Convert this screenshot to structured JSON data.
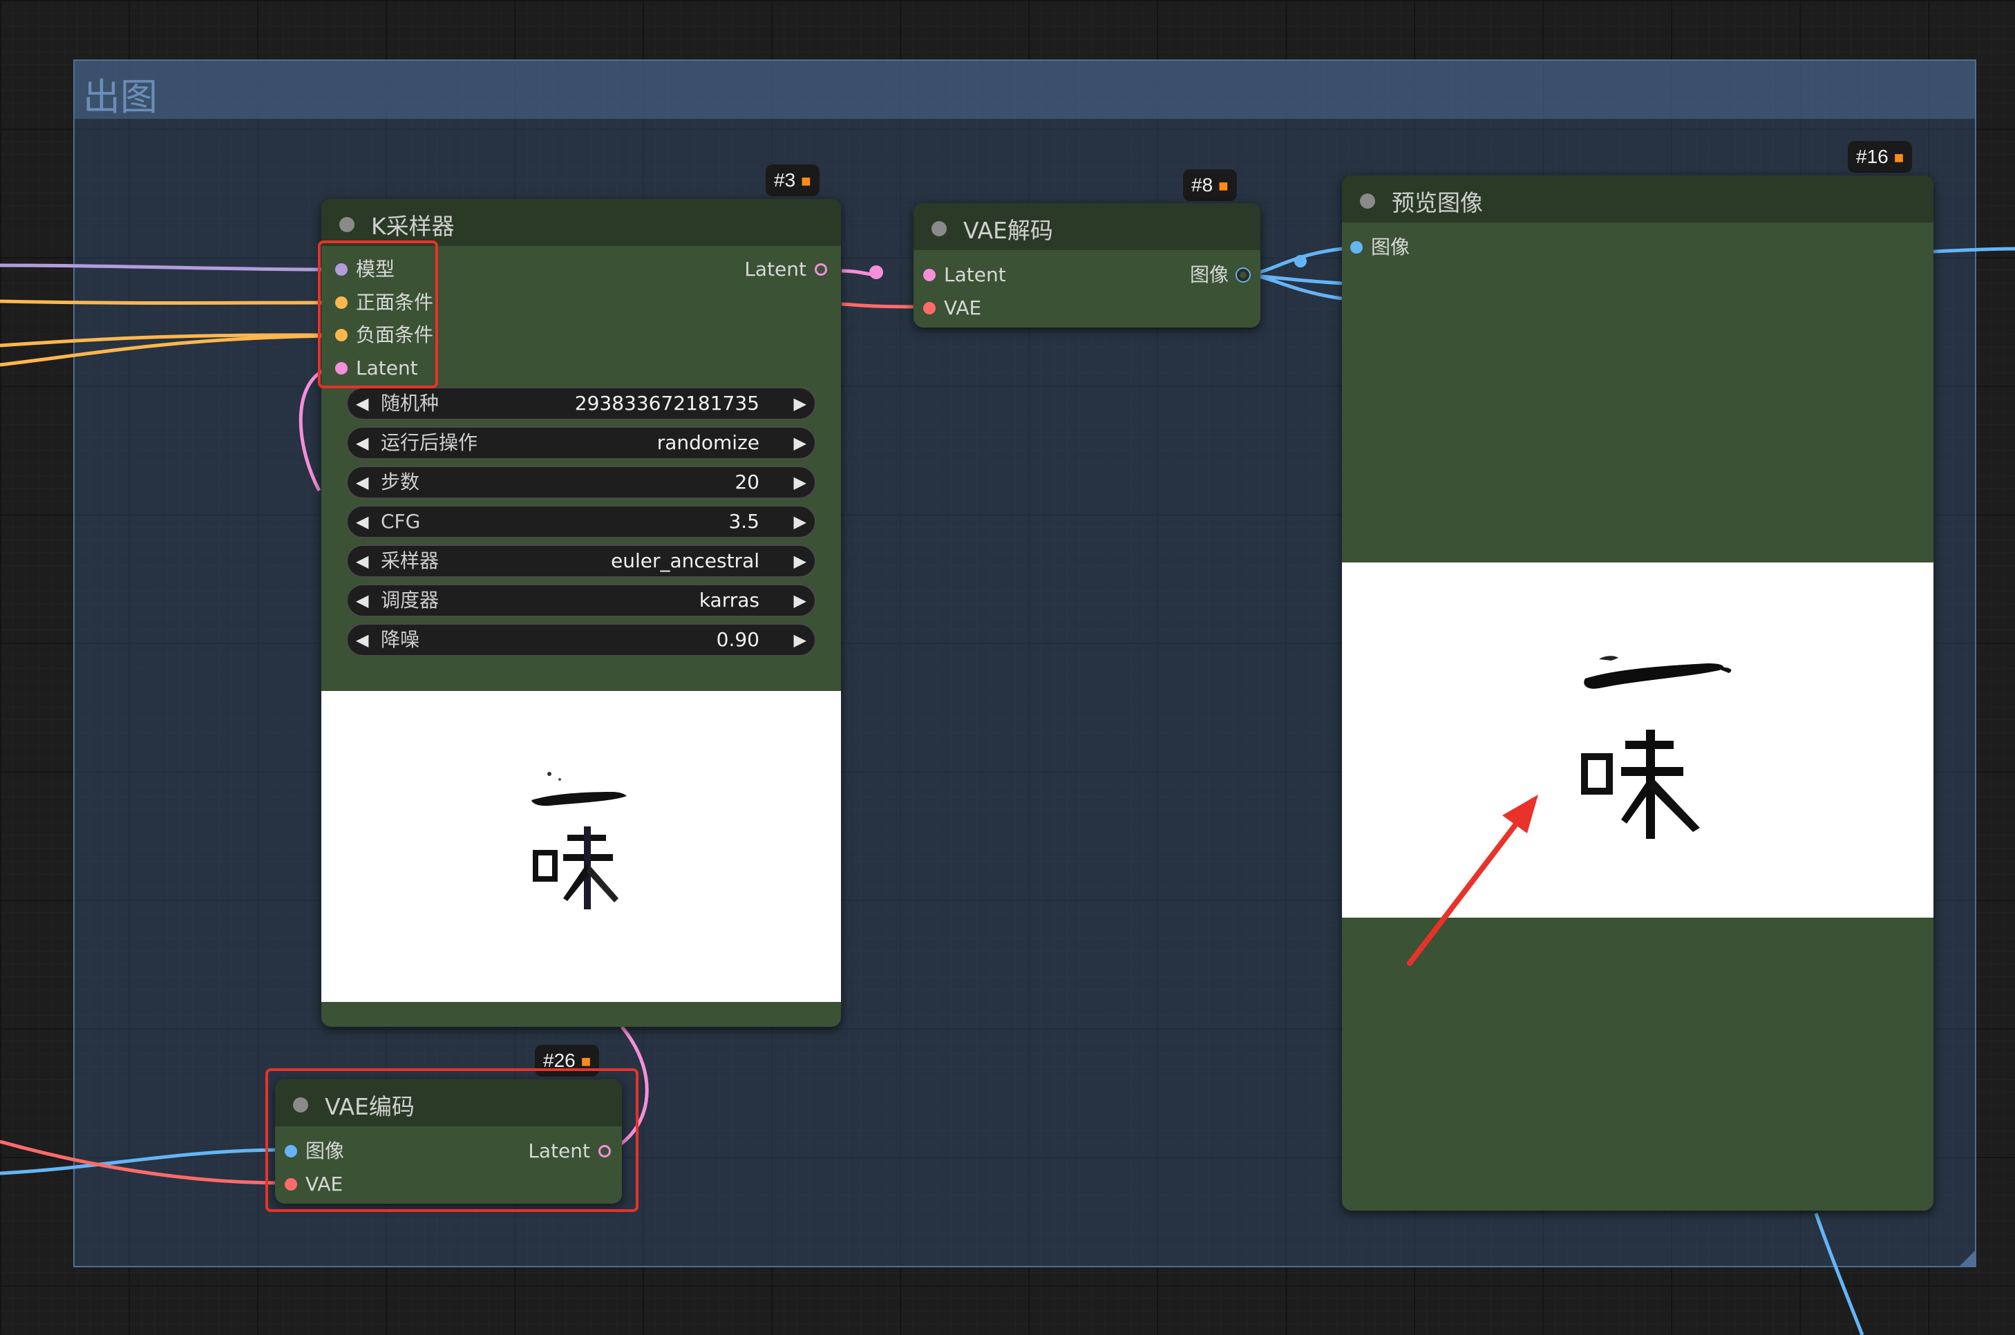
{
  "group": {
    "title": "出图"
  },
  "nodes": {
    "ksampler": {
      "badge": "#3",
      "title": "K采样器",
      "inputs": [
        {
          "label": "模型",
          "color": "#b39ddb"
        },
        {
          "label": "正面条件",
          "color": "#ffb74d"
        },
        {
          "label": "负面条件",
          "color": "#ffb74d"
        },
        {
          "label": "Latent",
          "color": "#f48fda"
        }
      ],
      "output": {
        "label": "Latent",
        "color": "#f48fda"
      },
      "widgets": [
        {
          "label": "随机种",
          "value": "293833672181735"
        },
        {
          "label": "运行后操作",
          "value": "randomize"
        },
        {
          "label": "步数",
          "value": "20"
        },
        {
          "label": "CFG",
          "value": "3.5"
        },
        {
          "label": "采样器",
          "value": "euler_ancestral"
        },
        {
          "label": "调度器",
          "value": "karras"
        },
        {
          "label": "降噪",
          "value": "0.90"
        }
      ]
    },
    "vae_decode": {
      "badge": "#8",
      "title": "VAE解码",
      "inputs": [
        {
          "label": "Latent",
          "color": "#f48fda"
        },
        {
          "label": "VAE",
          "color": "#ff6b6b"
        }
      ],
      "output": {
        "label": "图像",
        "color": "#64b5f6"
      }
    },
    "preview": {
      "badge": "#16",
      "title": "预览图像",
      "inputs": [
        {
          "label": "图像",
          "color": "#64b5f6"
        }
      ]
    },
    "vae_encode": {
      "badge": "#26",
      "title": "VAE编码",
      "inputs": [
        {
          "label": "图像",
          "color": "#64b5f6"
        },
        {
          "label": "VAE",
          "color": "#ff6b6b"
        }
      ],
      "output": {
        "label": "Latent",
        "color": "#f48fda"
      }
    }
  },
  "colors": {
    "node_body": "#3b5234",
    "node_header": "#2b3a26",
    "highlight": "#e8322a",
    "wire_model": "#b39ddb",
    "wire_cond": "#ffb74d",
    "wire_latent": "#f48fda",
    "wire_vae": "#ff6b6b",
    "wire_image": "#64b5f6"
  },
  "icons": {
    "badge": "fox-icon",
    "arrow_left": "triangle-left-icon",
    "arrow_right": "triangle-right-icon"
  }
}
